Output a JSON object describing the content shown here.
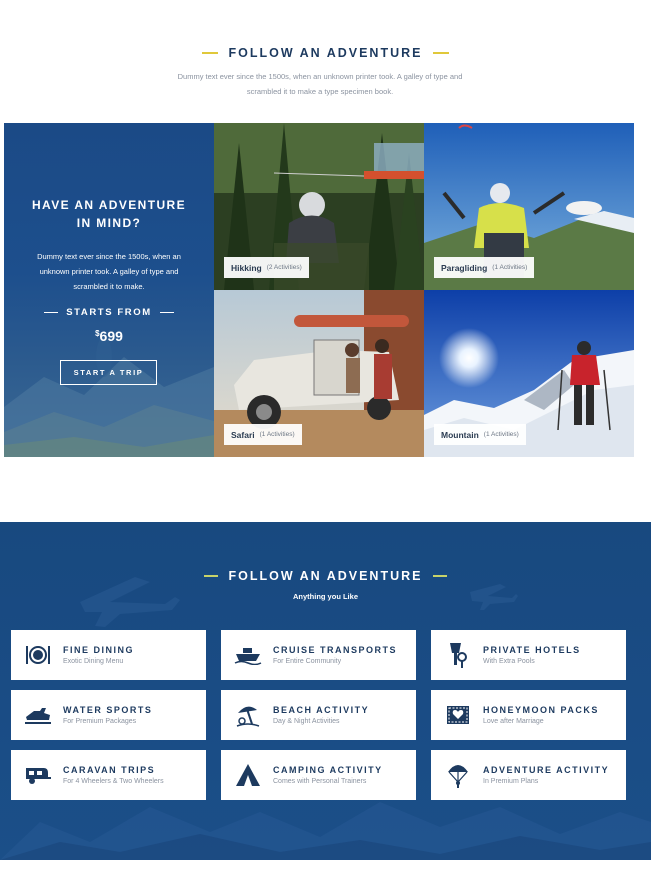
{
  "colors": {
    "brand_blue": "#1b4a86",
    "accent_yellow": "#e0c83a",
    "text_dark": "#1d3a5f"
  },
  "section1": {
    "title": "FOLLOW AN ADVENTURE",
    "subtitle_line1": "Dummy text ever since the 1500s, when an unknown printer took. A galley of type and",
    "subtitle_line2": "scrambled it to make a type specimen book."
  },
  "promo": {
    "title_line1": "HAVE AN ADVENTURE",
    "title_line2": "IN MIND?",
    "desc_line1": "Dummy text ever since the 1500s, when an",
    "desc_line2": "unknown printer took. A galley of type and",
    "desc_line3": "scrambled it to make.",
    "starts_from": "STARTS FROM",
    "price_currency": "$",
    "price_value": "699",
    "button": "START A TRIP"
  },
  "activities": [
    {
      "name": "Hikking",
      "count": "(2 Activities)",
      "icon": "hiking-photo"
    },
    {
      "name": "Paragliding",
      "count": "(1 Activities)",
      "icon": "paragliding-photo"
    },
    {
      "name": "Safari",
      "count": "(1 Activities)",
      "icon": "safari-photo"
    },
    {
      "name": "Mountain",
      "count": "(1 Activities)",
      "icon": "mountain-photo"
    }
  ],
  "section2": {
    "title": "FOLLOW AN ADVENTURE",
    "subtitle": "Anything you Like"
  },
  "services": [
    {
      "title": "FINE DINING",
      "subtitle": "Exotic Dining Menu",
      "icon": "dining-icon"
    },
    {
      "title": "CRUISE TRANSPORTS",
      "subtitle": "For Entire Community",
      "icon": "cruise-icon"
    },
    {
      "title": "PRIVATE HOTELS",
      "subtitle": "With Extra Pools",
      "icon": "hotel-icon"
    },
    {
      "title": "WATER SPORTS",
      "subtitle": "For Premium Packages",
      "icon": "jetski-icon"
    },
    {
      "title": "BEACH ACTIVITY",
      "subtitle": "Day & Night Activities",
      "icon": "beach-icon"
    },
    {
      "title": "HONEYMOON PACKS",
      "subtitle": "Love after Marriage",
      "icon": "honeymoon-icon"
    },
    {
      "title": "CARAVAN TRIPS",
      "subtitle": "For 4 Wheelers & Two Wheelers",
      "icon": "caravan-icon"
    },
    {
      "title": "CAMPING ACTIVITY",
      "subtitle": "Comes with Personal Trainers",
      "icon": "tent-icon"
    },
    {
      "title": "ADVENTURE ACTIVITY",
      "subtitle": "In Premium Plans",
      "icon": "parachute-icon"
    }
  ]
}
